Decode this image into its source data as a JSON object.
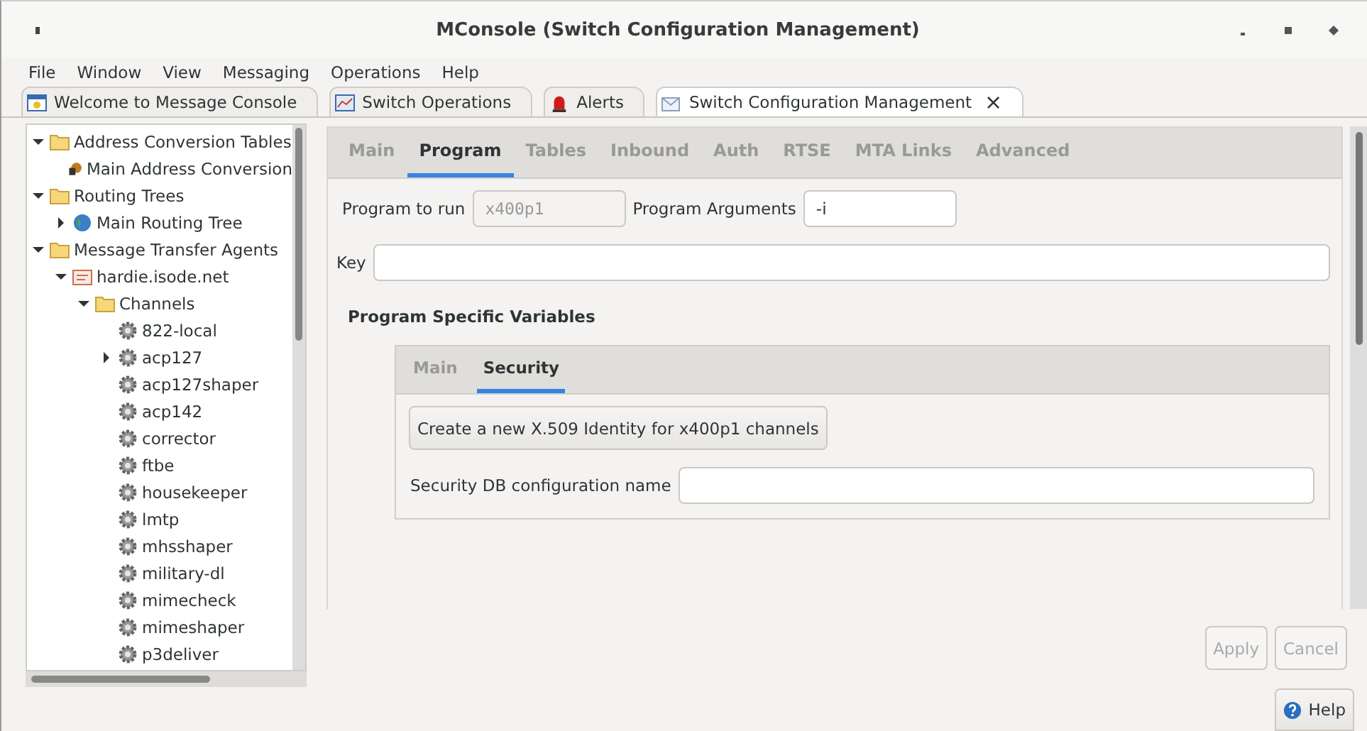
{
  "window": {
    "title": "MConsole (Switch Configuration Management)"
  },
  "menu": [
    "File",
    "Window",
    "View",
    "Messaging",
    "Operations",
    "Help"
  ],
  "doc_tabs": [
    {
      "label": "Welcome to Message Console",
      "kind": "welcome",
      "selected": false
    },
    {
      "label": "Switch Operations",
      "kind": "chart",
      "selected": false
    },
    {
      "label": "Alerts",
      "kind": "alert",
      "selected": false
    },
    {
      "label": "Switch Configuration Management",
      "kind": "mail",
      "selected": true,
      "close": "×"
    }
  ],
  "tree": [
    {
      "label": "Address Conversion Tables",
      "kind": "folder",
      "expanded": true,
      "children": [
        {
          "label": "Main Address Conversion",
          "kind": "node"
        }
      ]
    },
    {
      "label": "Routing Trees",
      "kind": "folder",
      "expanded": true,
      "children": [
        {
          "label": "Main Routing Tree",
          "kind": "globe",
          "expanded": false
        }
      ]
    },
    {
      "label": "Message Transfer Agents",
      "kind": "folder",
      "expanded": true,
      "children": [
        {
          "label": "hardie.isode.net",
          "kind": "host",
          "expanded": true,
          "children": [
            {
              "label": "Channels",
              "kind": "folder",
              "expanded": true,
              "children": [
                {
                  "label": "822-local",
                  "kind": "gear"
                },
                {
                  "label": "acp127",
                  "kind": "gear",
                  "expanded": false
                },
                {
                  "label": "acp127shaper",
                  "kind": "gear"
                },
                {
                  "label": "acp142",
                  "kind": "gear"
                },
                {
                  "label": "corrector",
                  "kind": "gear"
                },
                {
                  "label": "ftbe",
                  "kind": "gear"
                },
                {
                  "label": "housekeeper",
                  "kind": "gear"
                },
                {
                  "label": "lmtp",
                  "kind": "gear"
                },
                {
                  "label": "mhsshaper",
                  "kind": "gear"
                },
                {
                  "label": "military-dl",
                  "kind": "gear"
                },
                {
                  "label": "mimecheck",
                  "kind": "gear"
                },
                {
                  "label": "mimeshaper",
                  "kind": "gear"
                },
                {
                  "label": "p3deliver",
                  "kind": "gear"
                }
              ]
            }
          ]
        }
      ]
    }
  ],
  "config_tabs": [
    {
      "label": "Main",
      "selected": false
    },
    {
      "label": "Program",
      "selected": true
    },
    {
      "label": "Tables",
      "selected": false
    },
    {
      "label": "Inbound",
      "selected": false
    },
    {
      "label": "Auth",
      "selected": false
    },
    {
      "label": "RTSE",
      "selected": false
    },
    {
      "label": "MTA Links",
      "selected": false
    },
    {
      "label": "Advanced",
      "selected": false
    }
  ],
  "program": {
    "label": "Program to run",
    "value": "x400p1",
    "disabled": true
  },
  "arguments": {
    "label": "Program Arguments",
    "value": "-i"
  },
  "key": {
    "label": "Key"
  },
  "variables": {
    "heading": "Program Specific Variables",
    "tabs": [
      {
        "label": "Main",
        "selected": false
      },
      {
        "label": "Security",
        "selected": true
      }
    ],
    "create_button": "Create a new X.509 Identity for x400p1 channels",
    "db": {
      "label": "Security DB configuration name"
    }
  },
  "buttons": [
    {
      "label": "Apply",
      "disabled": true
    },
    {
      "label": "Cancel",
      "disabled": true
    }
  ],
  "help": "Help"
}
